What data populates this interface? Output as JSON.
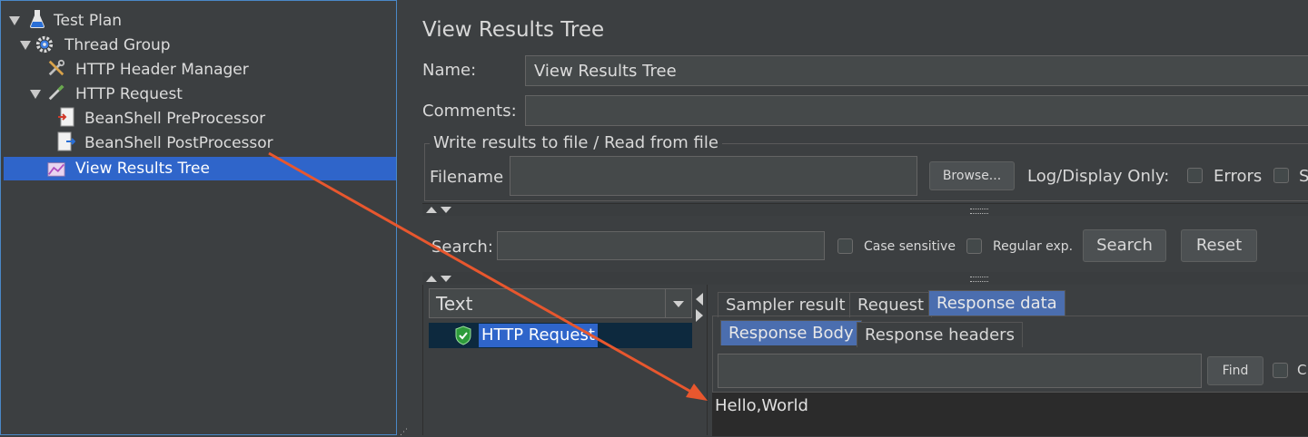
{
  "tree": {
    "items": [
      {
        "label": "Test Plan"
      },
      {
        "label": "Thread Group"
      },
      {
        "label": "HTTP Header Manager"
      },
      {
        "label": "HTTP Request"
      },
      {
        "label": "BeanShell PreProcessor"
      },
      {
        "label": "BeanShell PostProcessor"
      },
      {
        "label": "View Results Tree"
      }
    ]
  },
  "panel": {
    "title": "View Results Tree",
    "name_label": "Name:",
    "name_value": "View Results Tree",
    "comments_label": "Comments:",
    "comments_value": "",
    "file_group_title": "Write results to file / Read from file",
    "filename_label": "Filename",
    "filename_value": "",
    "browse_label": "Browse...",
    "log_display_label": "Log/Display Only:",
    "errors_label": "Errors",
    "successes_label_partial": "S"
  },
  "search": {
    "label": "Search:",
    "value": "",
    "case_sensitive_label": "Case sensitive",
    "regex_label": "Regular exp.",
    "search_button": "Search",
    "reset_button": "Reset"
  },
  "results": {
    "renderer_selected": "Text",
    "sample_item": "HTTP Request",
    "tabs": [
      "Sampler result",
      "Request",
      "Response data"
    ],
    "subtabs": [
      "Response Body",
      "Response headers"
    ],
    "find_value": "",
    "find_button": "Find",
    "find_option_partial": "C",
    "response_text": "Hello,World"
  },
  "annotation": {
    "color": "#e8572e"
  }
}
